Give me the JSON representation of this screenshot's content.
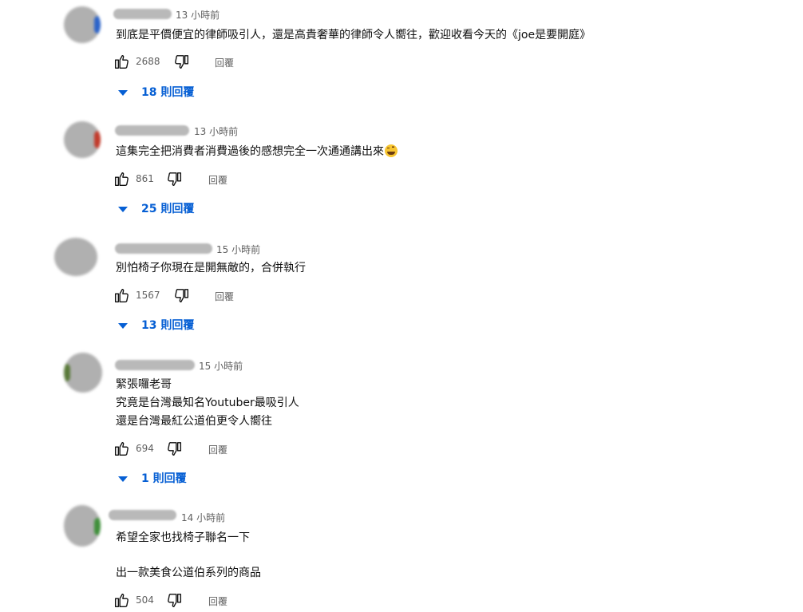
{
  "comments": [
    {
      "time": "13 小時前",
      "lines": [
        "到底是平價便宜的律師吸引人，還是高貴奢華的律師令人嚮往，歡迎收看今天的《joe是要開庭》"
      ],
      "likes": "2688",
      "reply_label": "回覆",
      "replies_label": "18 則回覆"
    },
    {
      "time": "13 小時前",
      "lines": [
        "這集完全把消費者消費過後的感想完全一次通通講出來"
      ],
      "emoji": "laughing-tears-emoji",
      "likes": "861",
      "reply_label": "回覆",
      "replies_label": "25 則回覆"
    },
    {
      "time": "15 小時前",
      "lines": [
        "別怕椅子你現在是開無敵的，合併執行"
      ],
      "likes": "1567",
      "reply_label": "回覆",
      "replies_label": "13 則回覆"
    },
    {
      "time": "15 小時前",
      "lines": [
        "緊張囉老哥",
        "究竟是台灣最知名Youtuber最吸引人",
        "還是台灣最紅公道伯更令人嚮往"
      ],
      "likes": "694",
      "reply_label": "回覆",
      "replies_label": "1 則回覆"
    },
    {
      "time": "14 小時前",
      "lines": [
        "希望全家也找椅子聯名一下",
        "",
        "出一款美食公道伯系列的商品"
      ],
      "likes": "504",
      "reply_label": "回覆"
    }
  ],
  "icons": {
    "like": "thumb-up-icon",
    "dislike": "thumb-down-icon",
    "expand": "caret-down-icon"
  },
  "colors": {
    "link_blue": "#065fd4",
    "meta_gray": "#606060",
    "text": "#0f0f0f"
  }
}
